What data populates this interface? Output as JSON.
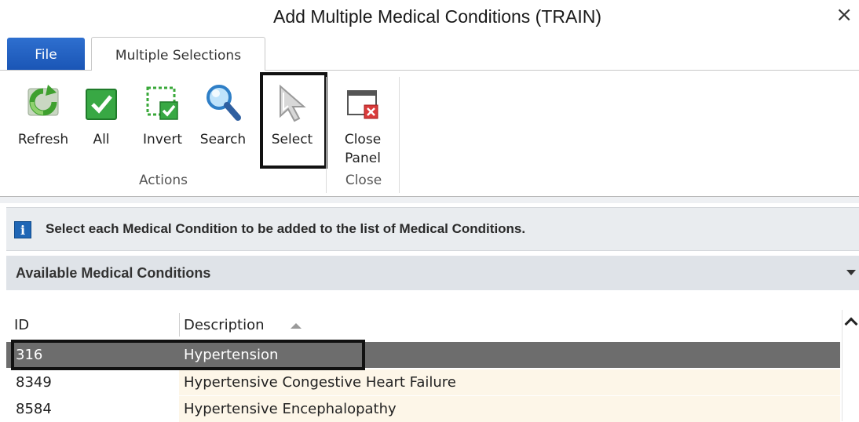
{
  "window": {
    "title": "Add Multiple Medical Conditions (TRAIN)",
    "close_glyph": "×"
  },
  "ribbon": {
    "tabs": [
      {
        "label": "File",
        "active": false
      },
      {
        "label": "Multiple Selections",
        "active": true
      }
    ],
    "buttons": [
      {
        "label": "Refresh",
        "icon": "refresh-icon"
      },
      {
        "label": "All",
        "icon": "check-all-icon"
      },
      {
        "label": "Invert",
        "icon": "invert-selection-icon"
      },
      {
        "label": "Search",
        "icon": "search-icon"
      },
      {
        "label": "Select",
        "icon": "cursor-arrow-icon"
      },
      {
        "label": "Close Panel",
        "label_line1": "Close",
        "label_line2": "Panel",
        "icon": "close-panel-icon"
      }
    ],
    "groups": [
      {
        "label": "Actions"
      },
      {
        "label": "Close"
      }
    ]
  },
  "info": {
    "icon": "info-icon",
    "text": "Select each Medical Condition to be added to the list of Medical Conditions."
  },
  "section": {
    "title": "Available Medical Conditions"
  },
  "grid": {
    "columns": [
      "ID",
      "Description"
    ],
    "sort": {
      "column": "Description",
      "direction": "ascending"
    },
    "rows": [
      {
        "id": "316",
        "description": "Hypertension",
        "selected": true
      },
      {
        "id": "8349",
        "description": "Hypertensive Congestive Heart Failure",
        "selected": false
      },
      {
        "id": "8584",
        "description": "Hypertensive Encephalopathy",
        "selected": false
      }
    ]
  },
  "colors": {
    "file_tab": "#1a55b5",
    "selected_row": "#6d6d6d",
    "row_tint": "#fdf6e8",
    "highlight_box": "#111111"
  }
}
